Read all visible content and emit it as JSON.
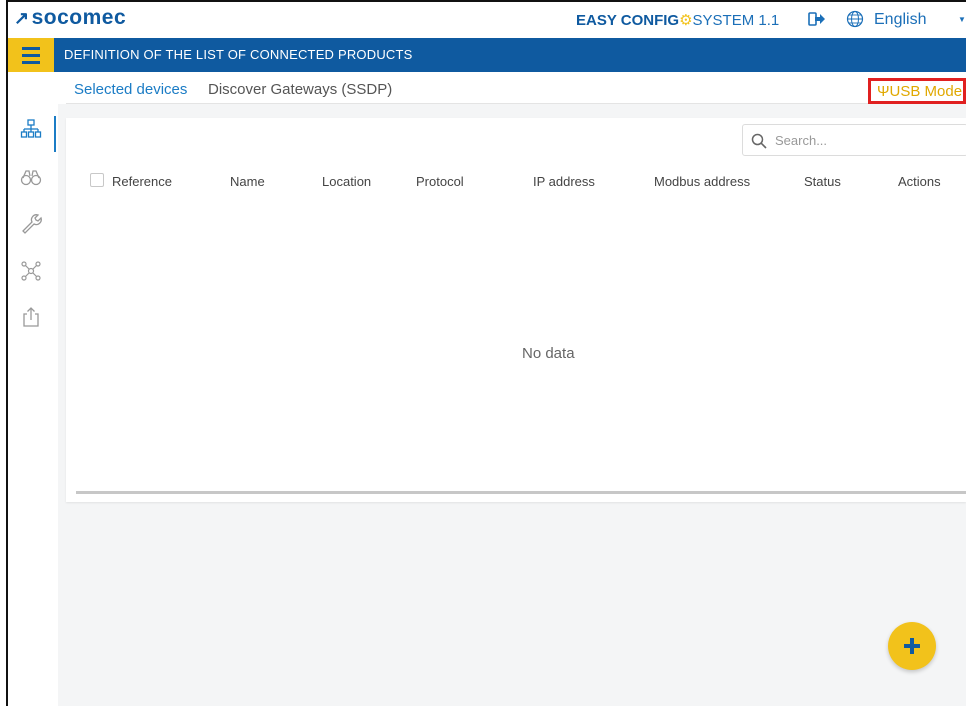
{
  "header": {
    "logo_text": "socomec",
    "product_bold": "EASY CONFIG",
    "product_gear": "⚙",
    "product_rest": "SYSTEM 1.1",
    "language": "English"
  },
  "titlebar": {
    "title": "DEFINITION OF THE LIST OF CONNECTED PRODUCTS"
  },
  "tabs": [
    {
      "label": "Selected devices"
    },
    {
      "label": "Discover Gateways (SSDP)"
    }
  ],
  "usb_mode": {
    "icon": "usb-icon",
    "label": "USB Mode"
  },
  "search": {
    "placeholder": "Search..."
  },
  "table": {
    "columns": [
      "Reference",
      "Name",
      "Location",
      "Protocol",
      "IP address",
      "Modbus address",
      "Status",
      "Actions"
    ],
    "empty_text": "No data"
  },
  "sidebar": {
    "items": [
      {
        "icon": "network-icon",
        "active": true
      },
      {
        "icon": "binoculars-icon",
        "active": false
      },
      {
        "icon": "wrench-icon",
        "active": false
      },
      {
        "icon": "topology-icon",
        "active": false
      },
      {
        "icon": "export-icon",
        "active": false
      }
    ]
  },
  "colors": {
    "brand_blue": "#0f5aa0",
    "accent_yellow": "#f2c21b",
    "highlight_red": "#e02020",
    "tab_active": "#1b7cc5"
  }
}
